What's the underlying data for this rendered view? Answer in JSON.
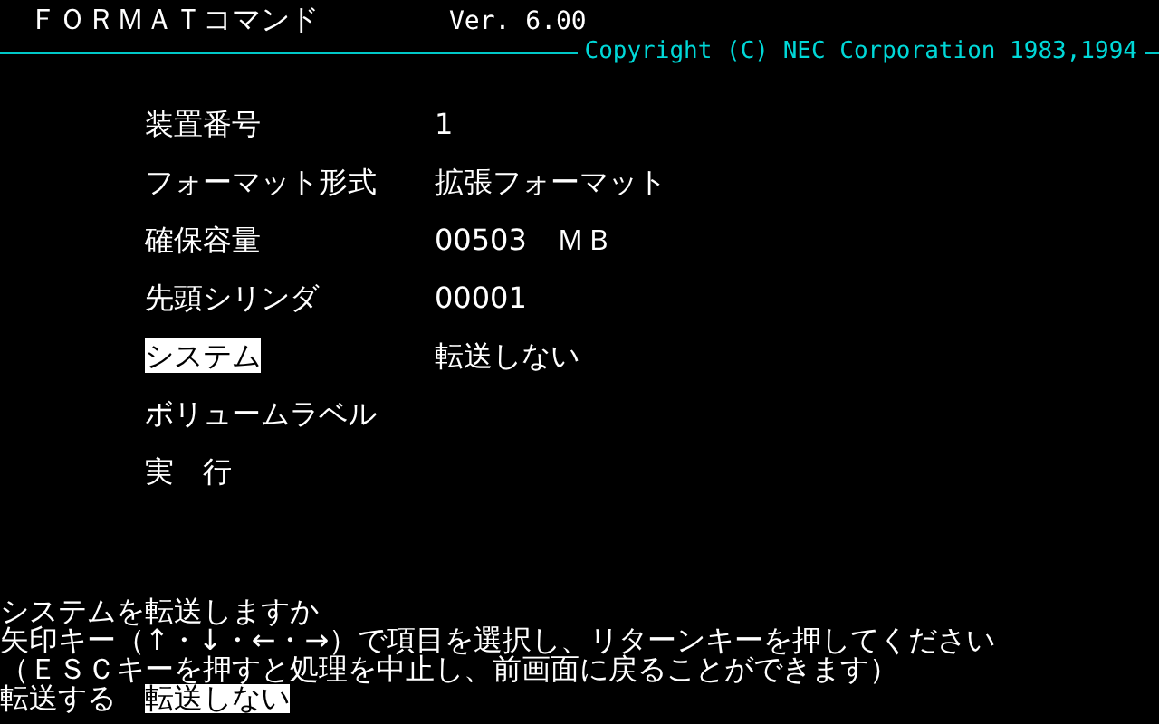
{
  "header": {
    "title": "ＦＯＲＭＡＴコマンド",
    "version": "Ver. 6.00",
    "copyright": "Copyright (C) NEC Corporation 1983,1994"
  },
  "settings": [
    {
      "label": "装置番号",
      "value": "1",
      "selected": false
    },
    {
      "label": "フォーマット形式",
      "value": "拡張フォーマット",
      "selected": false
    },
    {
      "label": "確保容量",
      "value": "00503　ＭＢ",
      "selected": false
    },
    {
      "label": "先頭シリンダ",
      "value": "00001",
      "selected": false
    },
    {
      "label": "システム",
      "value": "転送しない",
      "selected": true
    },
    {
      "label": "ボリュームラベル",
      "selected": false
    },
    {
      "label": "実　行",
      "selected": false
    }
  ],
  "prompt": {
    "question": "システムを転送しますか",
    "help": [
      "矢印キー（↑・↓・←・→）で項目を選択し、リターンキーを押してください",
      "（ＥＳＣキーを押すと処理を中止し、前画面に戻ることができます）"
    ]
  },
  "options": [
    {
      "label": "転送する",
      "selected": false
    },
    {
      "label": "転送しない",
      "selected": true
    }
  ]
}
